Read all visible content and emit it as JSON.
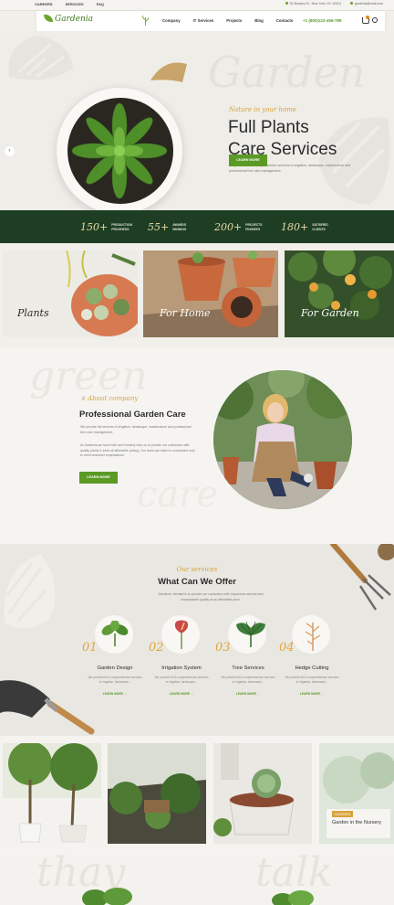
{
  "topbar": {
    "links": [
      "CAREERS",
      "SERVICES",
      "FAQ"
    ],
    "address": "52 Bowery St., New York, NY 10013",
    "email": "gardenia@mail.com"
  },
  "nav": {
    "logo": "Gardenia",
    "menu": [
      "Company",
      "IT Services",
      "Projects",
      "Blog",
      "Contacts"
    ],
    "phone": "+1 (800)123-456-789"
  },
  "hero": {
    "script": "Nature in your home",
    "title_line1": "Full Plants",
    "title_line2": "Care Services",
    "desc": "We provide full & comprehensive services in irrigation, landscape, maintenance and professional tree care management.",
    "button": "LEARN MORE",
    "watermark": "Garden"
  },
  "stats": [
    {
      "n": "150+",
      "l1": "PRODUCTION",
      "l2": "PROGRESS"
    },
    {
      "n": "55+",
      "l1": "AWARDS",
      "l2": "WINNING"
    },
    {
      "n": "200+",
      "l1": "PROJECTS",
      "l2": "FINISHED"
    },
    {
      "n": "180+",
      "l1": "SATISFIED",
      "l2": "CLIENTS"
    }
  ],
  "categories": [
    "Plants",
    "For Home",
    "For Garden"
  ],
  "about": {
    "watermark1": "green",
    "watermark2": "care",
    "script": "About company",
    "title": "Professional Garden Care",
    "p1": "We provide full services in irrigation, landscape, maintenance and professional tree care management.",
    "p2": "At Gardenia we have both and Nursery help us to provide our customers with quality plants & trees at affordable pricing. Our team can listen to consumers only to meet customer expectations.",
    "button": "LEARN MORE"
  },
  "services": {
    "script": "Our services",
    "title": "What Can We Offer",
    "desc": "Gardener Verdant is to provide our customers with responsive service and unsurpassed quality at an affordable price.",
    "items": [
      {
        "num": "01",
        "name": "Garden Design",
        "desc": "We provide full & comprehensive services in irrigation, landscape...",
        "more": "LEARN MORE"
      },
      {
        "num": "02",
        "name": "Irrigation System",
        "desc": "We provide full & comprehensive services in irrigation, landscape...",
        "more": "LEARN MORE"
      },
      {
        "num": "03",
        "name": "Tree Services",
        "desc": "We provide full & comprehensive services in irrigation, landscape...",
        "more": "LEARN MORE"
      },
      {
        "num": "04",
        "name": "Hedge Cutting",
        "desc": "We provide full & comprehensive services in irrigation, landscape...",
        "more": "LEARN MORE"
      }
    ]
  },
  "gallery": {
    "tag": "GARDEN",
    "caption": "Garden in the Nursery"
  },
  "testimonials": {
    "watermark1": "thay",
    "watermark2": "talk"
  },
  "colors": {
    "accent": "#5a9a25",
    "gold": "#d9a33a",
    "dark_green": "#1e3e23"
  }
}
